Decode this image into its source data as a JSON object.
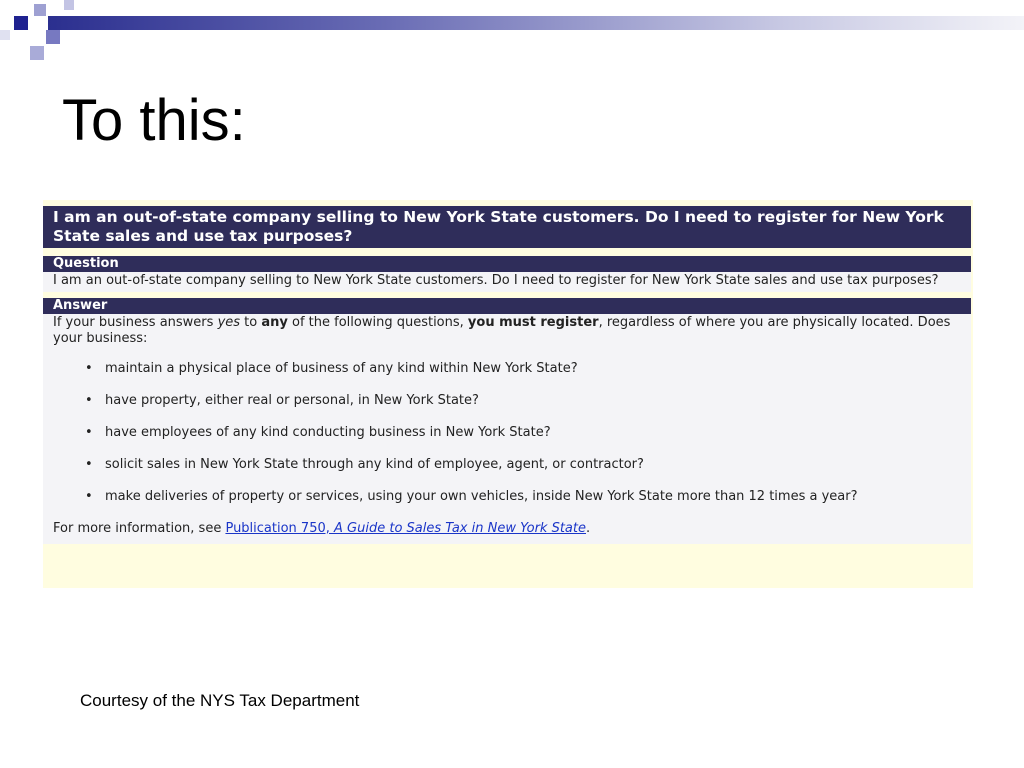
{
  "slide": {
    "title": "To this:",
    "caption": "Courtesy of the NYS Tax Department",
    "accent_color": "#2b2f8f"
  },
  "faq": {
    "title": "I am an out-of-state company selling to New York State customers. Do I need to register for New York State sales and use tax purposes?",
    "header_color": "#2f2d5a",
    "question": {
      "heading": "Question",
      "text": "I am an out-of-state company selling to New York State customers. Do I need to register for New York State sales and use tax purposes?"
    },
    "answer": {
      "heading": "Answer",
      "intro": {
        "part1": "If your business answers ",
        "yes": "yes",
        "part2": " to ",
        "any": "any",
        "part3": " of the following questions, ",
        "must": "you must register",
        "part4": ", regardless of where you are physically located. Does your business:"
      },
      "items": [
        "maintain a physical place of business of any kind within New York State?",
        "have property, either real or personal, in New York State?",
        "have employees of any kind conducting business in New York State?",
        "solicit sales in New York State through any kind of employee, agent, or contractor?",
        "make deliveries of property or services, using your own vehicles, inside New York State more than 12 times a year?"
      ],
      "more_info": {
        "prefix": "For more information, see ",
        "link_part1": "Publication 750, ",
        "link_part2": "A Guide to Sales Tax in New York State",
        "suffix": "."
      }
    }
  }
}
